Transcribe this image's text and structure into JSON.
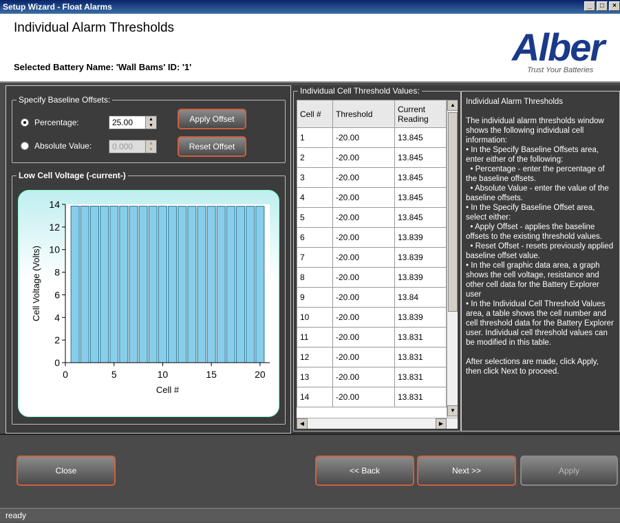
{
  "window": {
    "title": "Setup Wizard - Float Alarms"
  },
  "header": {
    "page_title": "Individual Alarm Thresholds",
    "battery_label": "Selected Battery Name: 'Wall Bams' ID: '1'",
    "logo_text": "Alber",
    "logo_tagline": "Trust Your Batteries"
  },
  "baseline": {
    "group_label": "Specify Baseline Offsets:",
    "percentage_label": "Percentage:",
    "percentage_value": "25.00",
    "absolute_label": "Absolute Value:",
    "absolute_value": "0.000",
    "apply_offset": "Apply Offset",
    "reset_offset": "Reset Offset",
    "selected": "percentage"
  },
  "chart_group_label": "Low Cell Voltage (-current-)",
  "chart_data": {
    "type": "bar",
    "title": "",
    "xlabel": "Cell #",
    "ylabel": "Cell Voltage (Volts)",
    "xlim": [
      0,
      21
    ],
    "ylim": [
      0,
      14
    ],
    "x_ticks": [
      0,
      5,
      10,
      15,
      20
    ],
    "y_ticks": [
      0,
      2,
      4,
      6,
      8,
      10,
      12,
      14
    ],
    "categories": [
      1,
      2,
      3,
      4,
      5,
      6,
      7,
      8,
      9,
      10,
      11,
      12,
      13,
      14,
      15,
      16,
      17,
      18,
      19,
      20
    ],
    "values": [
      13.845,
      13.845,
      13.845,
      13.845,
      13.845,
      13.839,
      13.839,
      13.839,
      13.84,
      13.839,
      13.831,
      13.831,
      13.831,
      13.831,
      13.831,
      13.831,
      13.831,
      13.831,
      13.831,
      13.831
    ],
    "bar_color": "#87ceeb"
  },
  "table": {
    "group_label": "Individual Cell Threshold Values:",
    "headers": [
      "Cell #",
      "Threshold",
      "Current Reading"
    ],
    "rows": [
      [
        "1",
        "-20.00",
        "13.845"
      ],
      [
        "2",
        "-20.00",
        "13.845"
      ],
      [
        "3",
        "-20.00",
        "13.845"
      ],
      [
        "4",
        "-20.00",
        "13.845"
      ],
      [
        "5",
        "-20.00",
        "13.845"
      ],
      [
        "6",
        "-20.00",
        "13.839"
      ],
      [
        "7",
        "-20.00",
        "13.839"
      ],
      [
        "8",
        "-20.00",
        "13.839"
      ],
      [
        "9",
        "-20.00",
        "13.84"
      ],
      [
        "10",
        "-20.00",
        "13.839"
      ],
      [
        "11",
        "-20.00",
        "13.831"
      ],
      [
        "12",
        "-20.00",
        "13.831"
      ],
      [
        "13",
        "-20.00",
        "13.831"
      ],
      [
        "14",
        "-20.00",
        "13.831"
      ]
    ]
  },
  "help": {
    "text": "Individual Alarm Thresholds\n\nThe individual alarm thresholds window shows the following individual cell information:\n• In the Specify Baseline Offsets area, enter either of the following:\n  • Percentage - enter the percentage of the baseline offsets.\n  • Absolute Value - enter the value of the baseline offsets.\n• In the Specify Baseline Offset area, select either:\n  • Apply Offset - applies the baseline offsets to the existing threshold values.\n  • Reset Offset - resets previously applied baseline offset value.\n• In the cell graphic data area, a graph shows the cell voltage, resistance and other cell data for the Battery Explorer user\n• In the Individual Cell Threshold Values area, a table shows the cell number and cell threshold data for the Battery Explorer user. Individual cell threshold values can be modified in this table.\n\nAfter selections are made, click Apply, then click Next to proceed."
  },
  "buttons": {
    "close": "Close",
    "back": "<< Back",
    "next": "Next >>",
    "apply": "Apply"
  },
  "status": {
    "text": "ready"
  }
}
